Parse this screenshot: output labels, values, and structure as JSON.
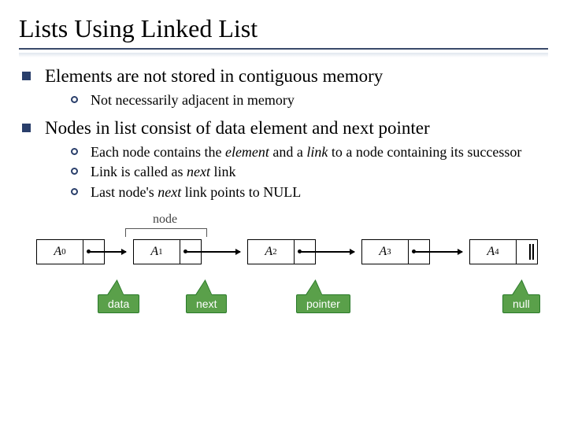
{
  "title": "Lists Using Linked List",
  "bullets": {
    "b1": "Elements are not stored in contiguous memory",
    "b1s1": "Not necessarily adjacent in memory",
    "b2": "Nodes in list consist of data element and next pointer",
    "b2s1_a": "Each node contains the ",
    "b2s1_em1": "element",
    "b2s1_b": " and a ",
    "b2s1_em2": "link",
    "b2s1_c": " to a node containing its successor",
    "b2s2_a": "Link is called as ",
    "b2s2_em": "next",
    "b2s2_b": " link",
    "b2s3_a": "Last node's ",
    "b2s3_em": "next",
    "b2s3_b": " link points to NULL"
  },
  "diagram": {
    "node_label": "node",
    "cells": [
      "A",
      "A",
      "A",
      "A",
      "A"
    ],
    "subs": [
      "0",
      "1",
      "2",
      "3",
      "4"
    ],
    "callouts": {
      "data": "data",
      "next": "next",
      "pointer": "pointer",
      "null": "null"
    }
  }
}
